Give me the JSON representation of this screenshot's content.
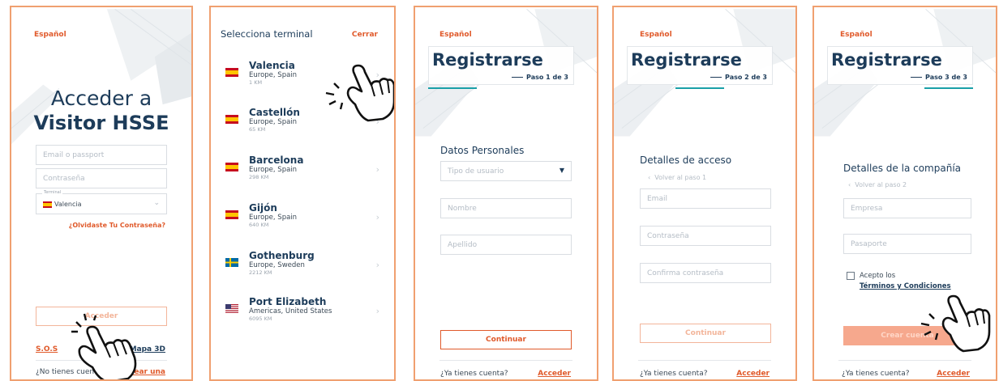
{
  "login": {
    "lang": "Español",
    "title_line1": "Acceder a",
    "title_line2": "Visitor HSSE",
    "email_placeholder": "Email o passport",
    "password_placeholder": "Contraseña",
    "terminal_label": "Terminal",
    "terminal_value": "Valencia",
    "forgot": "¿Olvidaste Tu Contraseña?",
    "submit": "Acceder",
    "sos": "S.O.S",
    "map": "Mapa 3D",
    "no_account": "¿No tienes cuenta?",
    "create": "Crear una"
  },
  "terminals": {
    "title": "Selecciona terminal",
    "close": "Cerrar",
    "items": [
      {
        "name": "Valencia",
        "region": "Europe, Spain",
        "dist": "1 KM",
        "flag": "spain"
      },
      {
        "name": "Castellón",
        "region": "Europe, Spain",
        "dist": "65 KM",
        "flag": "spain"
      },
      {
        "name": "Barcelona",
        "region": "Europe, Spain",
        "dist": "298 KM",
        "flag": "spain"
      },
      {
        "name": "Gijón",
        "region": "Europe, Spain",
        "dist": "640 KM",
        "flag": "spain"
      },
      {
        "name": "Gothenburg",
        "region": "Europe, Sweden",
        "dist": "2212 KM",
        "flag": "sweden"
      },
      {
        "name": "Port Elizabeth",
        "region": "Americas, United States",
        "dist": "6095 KM",
        "flag": "usa"
      }
    ]
  },
  "step1": {
    "lang": "Español",
    "title": "Registrarse",
    "step": "Paso 1 de 3",
    "section": "Datos Personales",
    "user_type": "Tipo de usuario",
    "name": "Nombre",
    "surname": "Apellido",
    "continue": "Continuar",
    "have_account": "¿Ya tienes cuenta?",
    "login": "Acceder"
  },
  "step2": {
    "lang": "Español",
    "title": "Registrarse",
    "step": "Paso 2 de 3",
    "section": "Detalles de acceso",
    "back": "Volver al paso 1",
    "email": "Email",
    "password": "Contraseña",
    "confirm": "Confirma contraseña",
    "continue": "Continuar",
    "have_account": "¿Ya tienes cuenta?",
    "login": "Acceder"
  },
  "step3": {
    "lang": "Español",
    "title": "Registrarse",
    "step": "Paso 3 de 3",
    "section": "Detalles de la compañía",
    "back": "Volver al paso 2",
    "company": "Empresa",
    "passport": "Pasaporte",
    "accept": "Acepto los",
    "terms": "Términos y Condiciones",
    "submit": "Crear cuenta",
    "have_account": "¿Ya tienes cuenta?",
    "login": "Acceder"
  },
  "colors": {
    "accent": "#e05a2b",
    "navy": "#1d3c5a",
    "teal": "#1aa0a8",
    "panel_border": "#f0a070"
  }
}
